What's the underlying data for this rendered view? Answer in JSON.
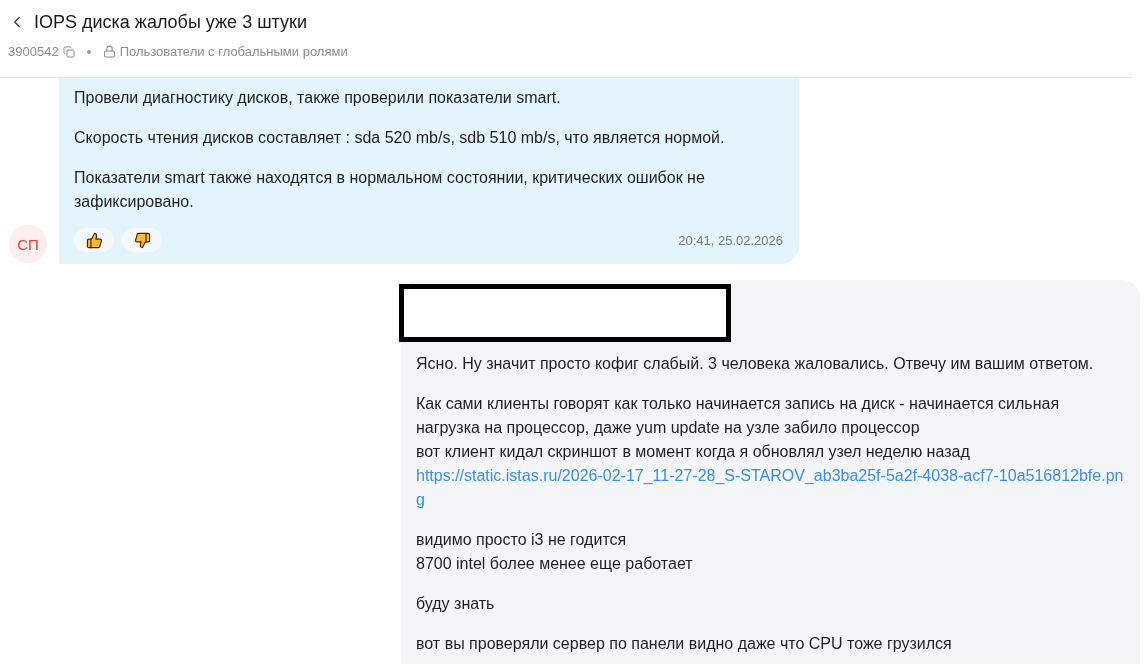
{
  "header": {
    "title": "IOPS диска жалобы уже 3 штуки",
    "ticket_id": "3900542",
    "visibility": "Пользователи с глобальными ролями"
  },
  "messages": [
    {
      "kind": "incoming",
      "author_initials": "СП",
      "time": "20:41, 25.02.2026",
      "redacted": false,
      "reactions": [
        {
          "kind": "like"
        },
        {
          "kind": "dislike"
        }
      ],
      "paragraphs": [
        [
          {
            "kind": "text",
            "text": "Провели диагностику дисков, также проверили показатели smart."
          }
        ],
        [
          {
            "kind": "text",
            "text": "Скорость чтения дисков составляет : sda 520 mb/s, sdb 510 mb/s, что является нормой."
          }
        ],
        [
          {
            "kind": "text",
            "text": "Показатели smart также находятся в нормальном состоянии, критических ошибок не зафиксировано."
          }
        ]
      ]
    },
    {
      "kind": "outgoing",
      "redacted": true,
      "paragraphs": [
        [
          {
            "kind": "text",
            "text": "Ясно. Ну значит просто кофиг слабый. 3 человека жаловались. Отвечу им вашим ответом."
          }
        ],
        [
          {
            "kind": "text",
            "text": "Как сами клиенты говорят как только начинается запись на диск - начинается сильная нагрузка на процессор, даже yum update на узле забило процессор"
          },
          {
            "kind": "text",
            "text": "вот клиент кидал скриншот в момент когда я обновлял узел неделю назад"
          },
          {
            "kind": "link",
            "text": "https://static.istas.ru/2026-02-17_11-27-28_S-STAROV_ab3ba25f-5a2f-4038-acf7-10a516812bfe.png"
          }
        ],
        [
          {
            "kind": "text",
            "text": "видимо просто i3 не годится"
          },
          {
            "kind": "text",
            "text": "8700 intel более менее еще работает"
          }
        ],
        [
          {
            "kind": "text",
            "text": "буду знать"
          }
        ],
        [
          {
            "kind": "text",
            "text": "вот вы проверяли сервер по панели видно даже что CPU тоже грузился"
          }
        ]
      ]
    }
  ]
}
